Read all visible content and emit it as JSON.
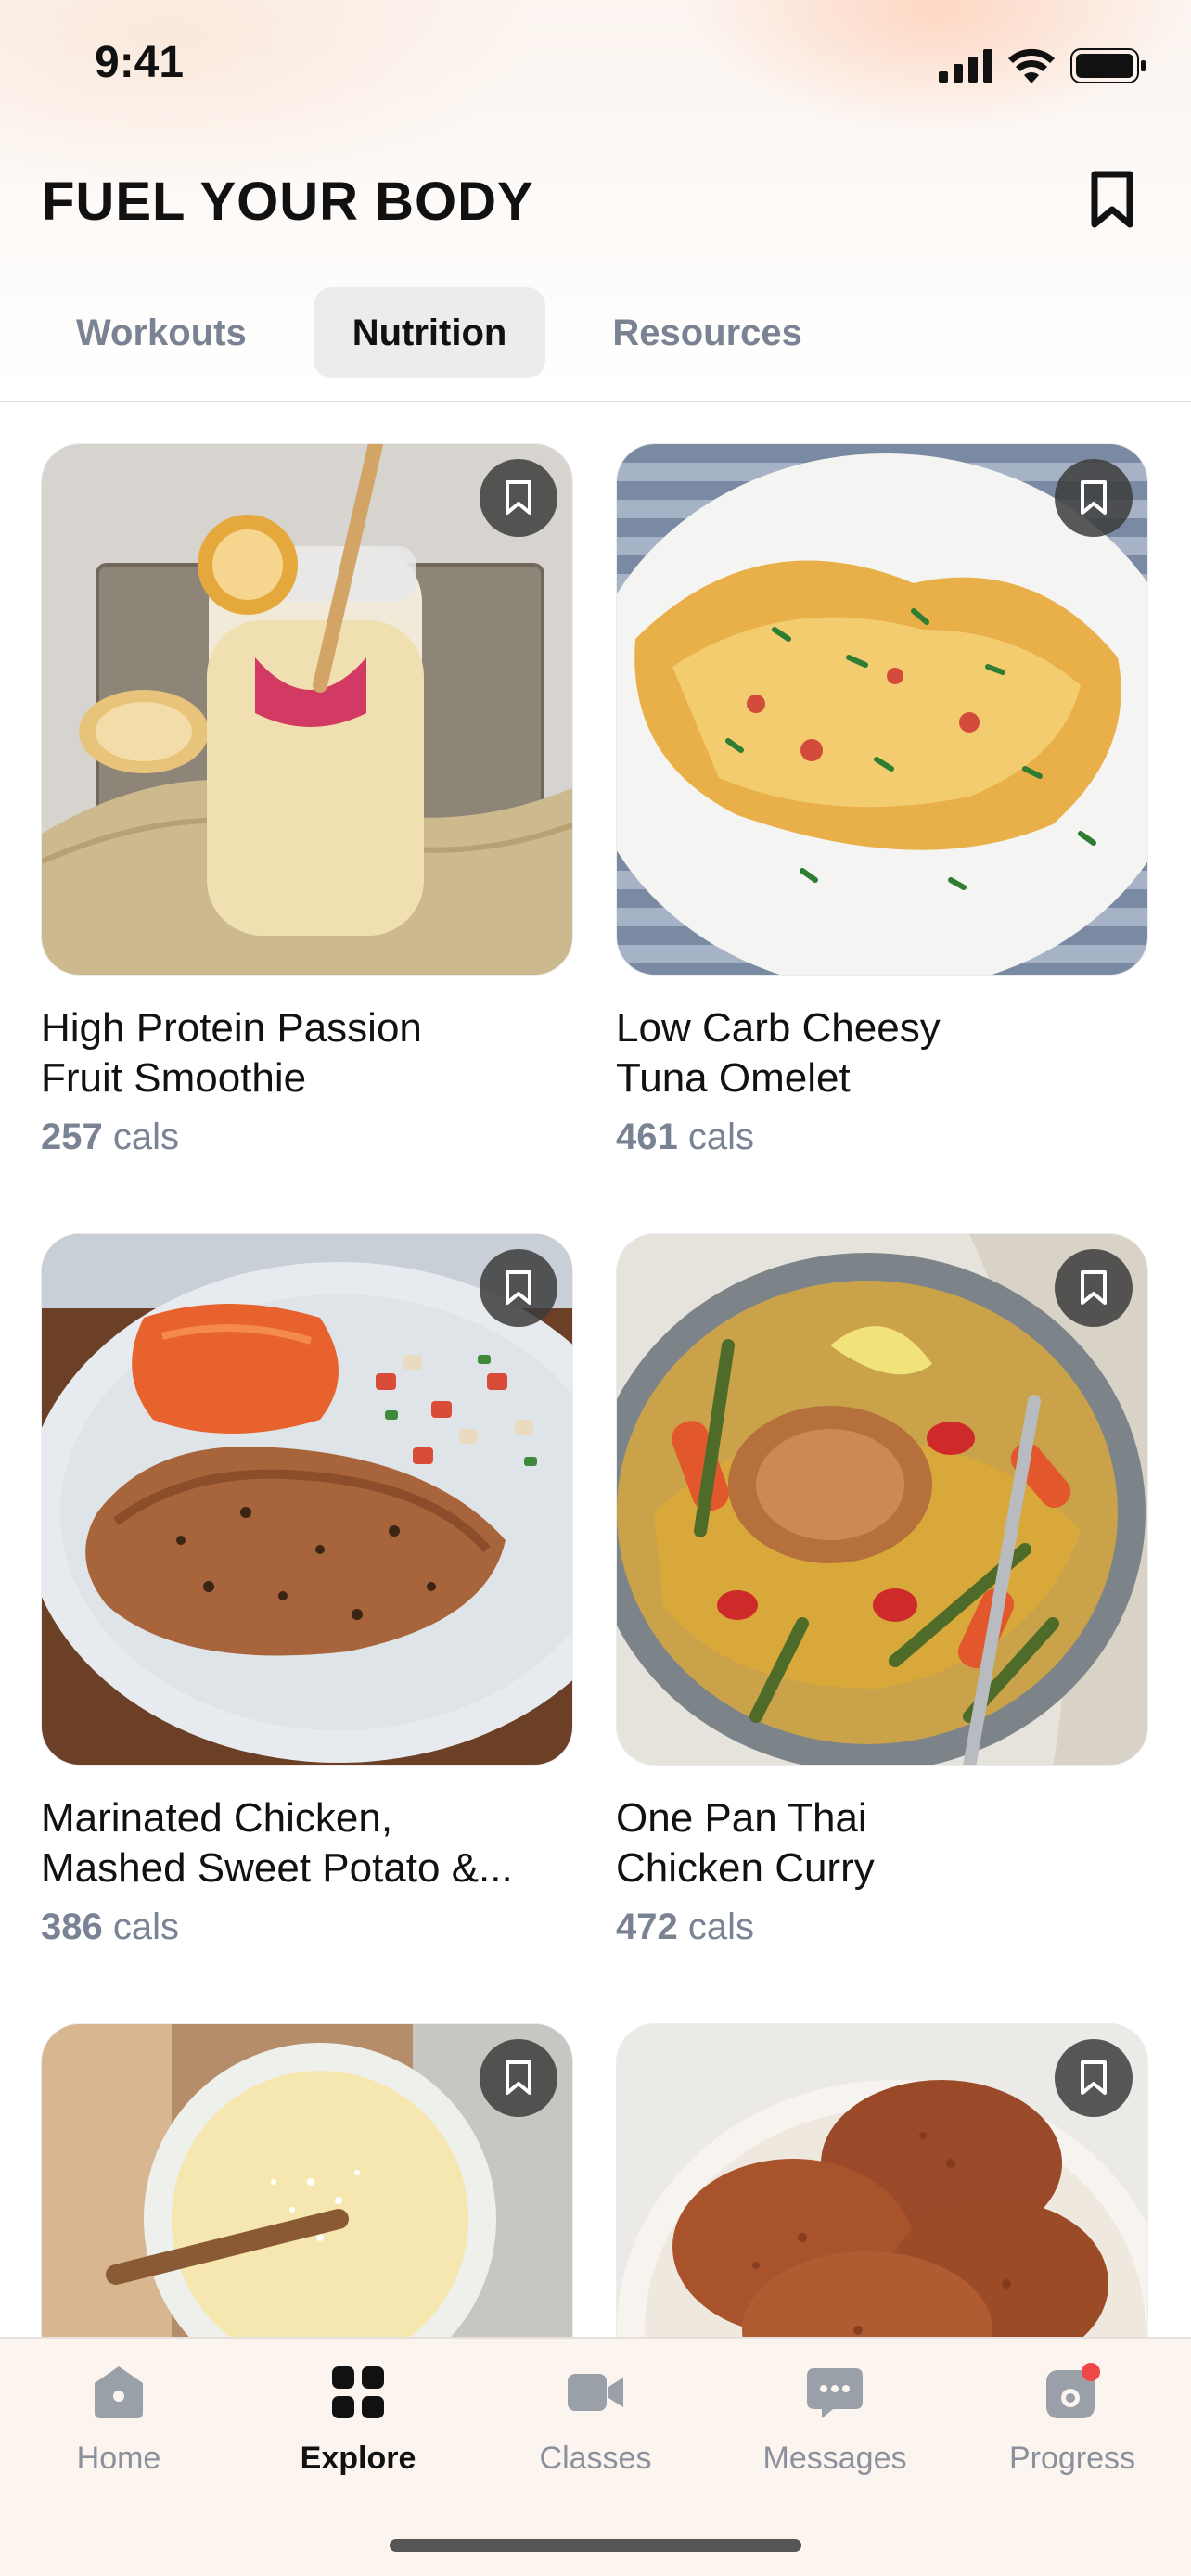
{
  "status_bar": {
    "time": "9:41"
  },
  "header": {
    "title": "FUEL YOUR BODY",
    "bookmark_icon": "bookmark-icon"
  },
  "tabs": [
    {
      "label": "Workouts",
      "active": false
    },
    {
      "label": "Nutrition",
      "active": true
    },
    {
      "label": "Resources",
      "active": false
    }
  ],
  "recipes": [
    {
      "title_line1": "High Protein Passion",
      "title_line2": "Fruit Smoothie",
      "cals_value": "257",
      "cals_unit": "cals",
      "image": "smoothie-jar-photo"
    },
    {
      "title_line1": "Low Carb Cheesy",
      "title_line2": "Tuna Omelet",
      "cals_value": "461",
      "cals_unit": "cals",
      "image": "omelet-plate-photo"
    },
    {
      "title_line1": "Marinated Chicken,",
      "title_line2": "Mashed Sweet Potato &...",
      "cals_value": "386",
      "cals_unit": "cals",
      "image": "chicken-plate-photo"
    },
    {
      "title_line1": "One Pan Thai",
      "title_line2": "Chicken Curry",
      "cals_value": "472",
      "cals_unit": "cals",
      "image": "curry-bowl-photo"
    },
    {
      "image": "coconut-drink-photo"
    },
    {
      "image": "patties-bowl-photo"
    }
  ],
  "tab_bar": [
    {
      "label": "Home",
      "icon": "home-icon",
      "active": false
    },
    {
      "label": "Explore",
      "icon": "grid-icon",
      "active": true
    },
    {
      "label": "Classes",
      "icon": "video-camera-icon",
      "active": false
    },
    {
      "label": "Messages",
      "icon": "chat-bubble-icon",
      "active": false
    },
    {
      "label": "Progress",
      "icon": "progress-icon",
      "active": false,
      "badge": true
    }
  ],
  "colors": {
    "muted_text": "#7a8394",
    "badge": "#f04848",
    "active_tab_bg": "#ececec"
  }
}
